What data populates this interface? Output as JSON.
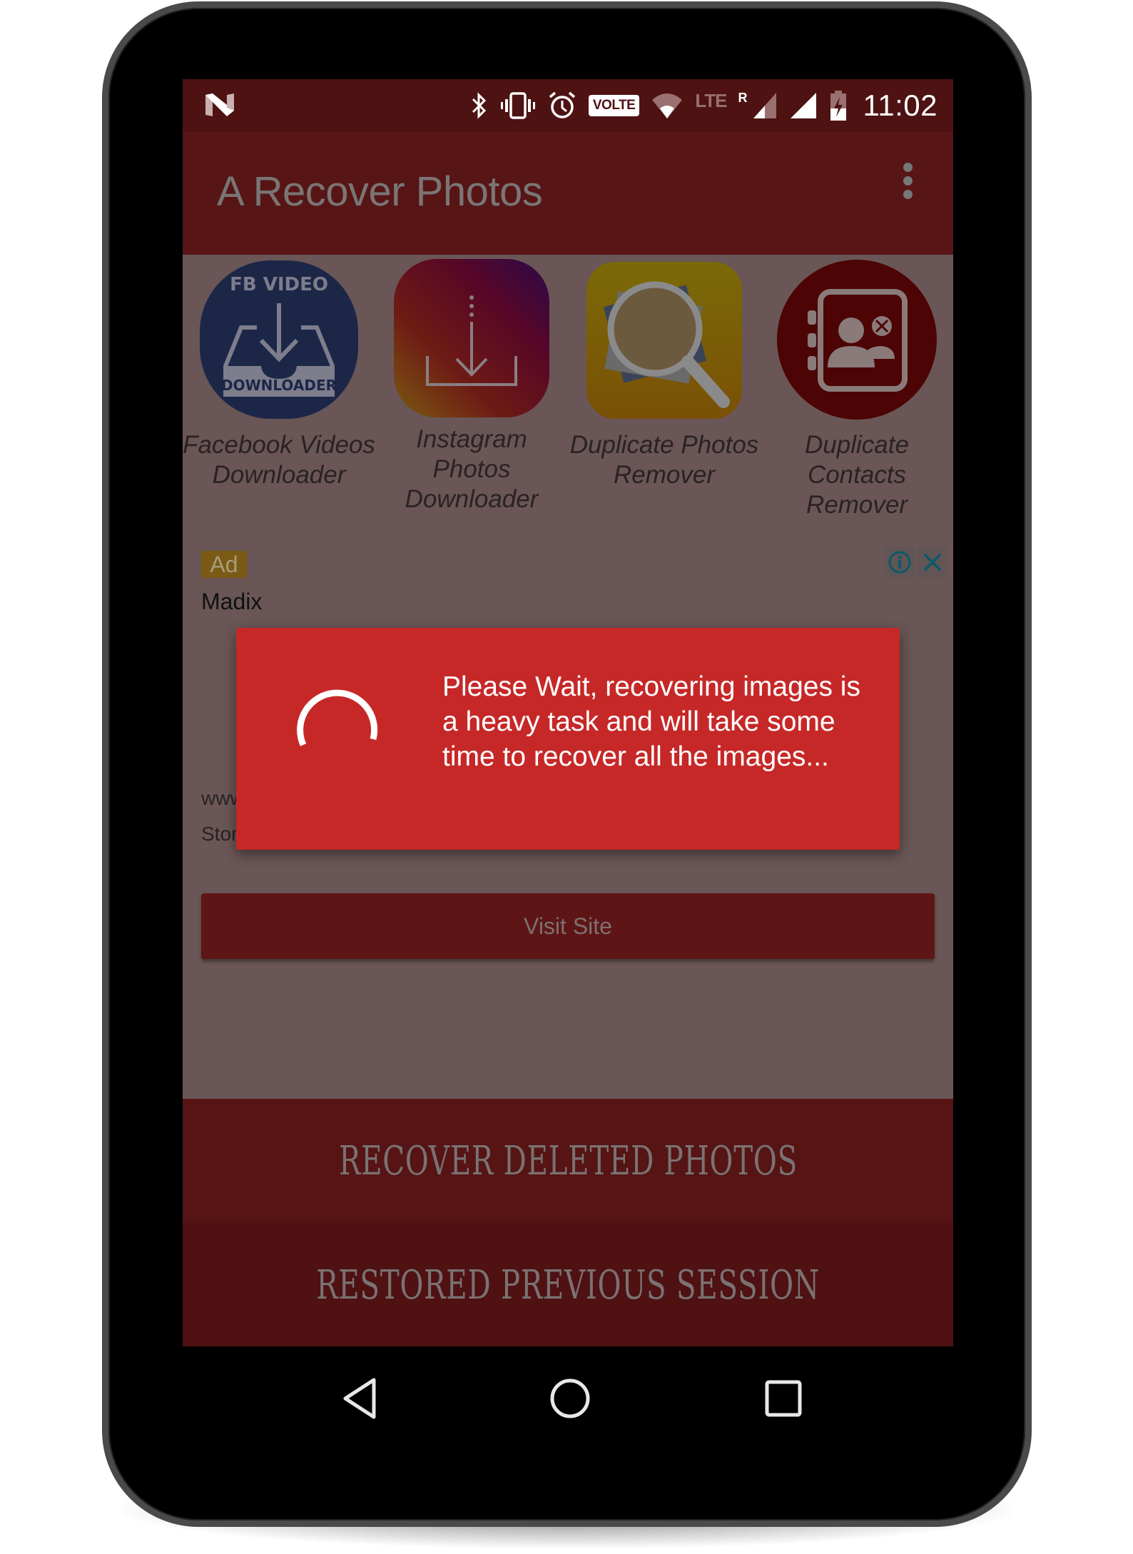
{
  "status_bar": {
    "time": "11:02",
    "icons": [
      "android-n-icon",
      "bluetooth-icon",
      "vibrate-icon",
      "alarm-icon",
      "volte-icon",
      "wifi-icon",
      "lte-icon",
      "roaming-signal-icon",
      "signal-icon",
      "battery-charging-icon"
    ],
    "volte_label": "VOLTE",
    "lte_label": "LTE",
    "roaming_label": "R"
  },
  "app_bar": {
    "title": "A Recover Photos",
    "menu_icon": "overflow-menu-icon"
  },
  "promo_apps": [
    {
      "label": "Facebook Videos Downloader",
      "icon": "fb-video-downloader-icon",
      "icon_top_text": "FB VIDEO",
      "icon_bottom_text": "DOWNLOADER"
    },
    {
      "label": "Instagram Photos Downloader",
      "icon": "instagram-downloader-icon"
    },
    {
      "label": "Duplicate Photos Remover",
      "icon": "duplicate-photos-icon"
    },
    {
      "label": "Duplicate Contacts Remover",
      "icon": "duplicate-contacts-icon"
    }
  ],
  "ad": {
    "badge": "Ad",
    "advertiser": "Madix",
    "url": "www.madixinc.com",
    "description": "Store fixtures that lift sales of liquor store merchandise.",
    "cta": "Visit Site",
    "info_icon": "info-icon",
    "close_icon": "close-icon"
  },
  "actions": {
    "recover": "RECOVER DELETED PHOTOS",
    "restored": "RESTORED PREVIOUS SESSION"
  },
  "dialog": {
    "message": "Please Wait, recovering images is a heavy task and will take some time to recover all the images...",
    "icon": "loading-spinner-icon"
  },
  "nav": {
    "back": "back-icon",
    "home": "home-icon",
    "recents": "recents-icon"
  },
  "colors": {
    "status_bar": "#4e1212",
    "app_bar": "#571516",
    "dialog": "#c62828",
    "dim_content": "#6a5656"
  }
}
